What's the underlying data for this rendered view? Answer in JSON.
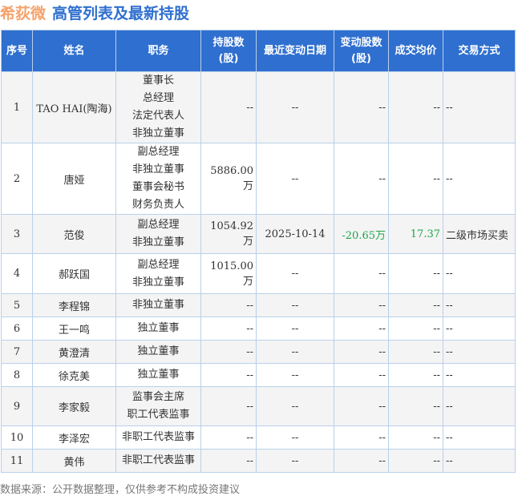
{
  "header": {
    "company": "希荻微",
    "title": "高管列表及最新持股"
  },
  "columns": [
    "序号",
    "姓名",
    "职务",
    "持股数\n(股)",
    "最近变动日期",
    "变动股数\n(股)",
    "成交均价",
    "交易方式"
  ],
  "rows": [
    {
      "no": "1",
      "name": "TAO HAI(陶海)",
      "duties": [
        "董事长",
        "总经理",
        "法定代表人",
        "非独立董事"
      ],
      "shares": "--",
      "date": "--",
      "change": "--",
      "price": "--",
      "method": "--"
    },
    {
      "no": "2",
      "name": "唐娅",
      "duties": [
        "副总经理",
        "非独立董事",
        "董事会秘书",
        "财务负责人"
      ],
      "shares": "5886.00万",
      "date": "--",
      "change": "--",
      "price": "--",
      "method": "--"
    },
    {
      "no": "3",
      "name": "范俊",
      "duties": [
        "副总经理",
        "非独立董事"
      ],
      "shares": "1054.92万",
      "date": "2025-10-14",
      "change": "-20.65万",
      "price": "17.37",
      "method": "二级市场买卖"
    },
    {
      "no": "4",
      "name": "郝跃国",
      "duties": [
        "副总经理",
        "非独立董事"
      ],
      "shares": "1015.00万",
      "date": "--",
      "change": "--",
      "price": "--",
      "method": "--"
    },
    {
      "no": "5",
      "name": "李程锦",
      "duties": [
        "非独立董事"
      ],
      "shares": "--",
      "date": "--",
      "change": "--",
      "price": "--",
      "method": "--"
    },
    {
      "no": "6",
      "name": "王一鸣",
      "duties": [
        "独立董事"
      ],
      "shares": "--",
      "date": "--",
      "change": "--",
      "price": "--",
      "method": "--"
    },
    {
      "no": "7",
      "name": "黄澄清",
      "duties": [
        "独立董事"
      ],
      "shares": "--",
      "date": "--",
      "change": "--",
      "price": "--",
      "method": "--"
    },
    {
      "no": "8",
      "name": "徐克美",
      "duties": [
        "独立董事"
      ],
      "shares": "--",
      "date": "--",
      "change": "--",
      "price": "--",
      "method": "--"
    },
    {
      "no": "9",
      "name": "李家毅",
      "duties": [
        "监事会主席",
        "职工代表监事"
      ],
      "shares": "--",
      "date": "--",
      "change": "--",
      "price": "--",
      "method": "--"
    },
    {
      "no": "10",
      "name": "李泽宏",
      "duties": [
        "非职工代表监事"
      ],
      "shares": "--",
      "date": "--",
      "change": "--",
      "price": "--",
      "method": "--"
    },
    {
      "no": "11",
      "name": "黄伟",
      "duties": [
        "非职工代表监事"
      ],
      "shares": "--",
      "date": "--",
      "change": "--",
      "price": "--",
      "method": "--"
    }
  ],
  "footer": "数据来源：公开数据整理，仅供参考不构成投资建议",
  "colors": {
    "header_bg": "#2f6fcf",
    "company": "#f5a26b",
    "positive": "#1aa64a"
  }
}
